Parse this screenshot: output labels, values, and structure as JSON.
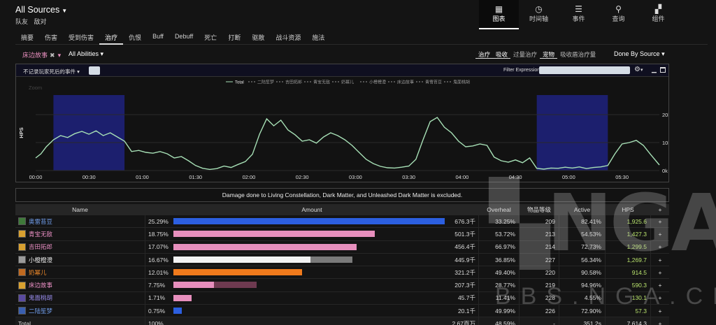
{
  "header": {
    "source_title": "All Sources",
    "source_sub": [
      "队友",
      "敌对"
    ],
    "nav": [
      {
        "label": "图表",
        "icon": "grid-icon",
        "glyph": "▦",
        "active": true
      },
      {
        "label": "时间轴",
        "icon": "clock-icon",
        "glyph": "◷",
        "active": false
      },
      {
        "label": "事件",
        "icon": "list-icon",
        "glyph": "☰",
        "active": false
      },
      {
        "label": "查询",
        "icon": "pin-icon",
        "glyph": "⚲",
        "active": false
      },
      {
        "label": "组件",
        "icon": "widgets-icon",
        "glyph": "▞",
        "active": false
      }
    ]
  },
  "tabs": [
    "摘要",
    "伤害",
    "受到伤害",
    "治疗",
    "仇恨",
    "Buff",
    "Debuff",
    "死亡",
    "打断",
    "驱散",
    "战斗资源",
    "施法"
  ],
  "active_tab": "治疗",
  "filters": {
    "player": "床边故事",
    "abilities": "All Abilities",
    "metric_tabs": [
      "治疗",
      "吸收",
      "过量治疗",
      "宠物",
      "吸收盾治疗量"
    ],
    "metric_active": [
      true,
      true,
      false,
      true,
      false
    ],
    "done_by": "Done By Source"
  },
  "chart_panel": {
    "death_filter": "不记录玩家死后的事件",
    "filter_label": "Filter Expression:"
  },
  "chart_data": {
    "type": "line",
    "legend": [
      "Total",
      "二陆笙梦",
      "吉田拓郎",
      "青宝无敌",
      "奶幂儿",
      "小橙橙澄",
      "床边故事",
      "青雪苔豆",
      "鬼面桃胡"
    ],
    "zoom_label": "Zoom",
    "ylabel": "HPS",
    "ylim": [
      0,
      27000
    ],
    "yticks": [
      "0k",
      "10k",
      "20k"
    ],
    "xlim": [
      0,
      351
    ],
    "xticks": [
      "00:00",
      "00:30",
      "01:00",
      "01:30",
      "02:00",
      "02:30",
      "03:00",
      "03:30",
      "04:00",
      "04:30",
      "05:00",
      "05:30"
    ],
    "highlight_ranges": [
      [
        10,
        50
      ],
      [
        282,
        322
      ]
    ],
    "series": [
      {
        "name": "Total",
        "color": "#a7e0b6",
        "x": [
          0,
          3,
          6,
          10,
          14,
          18,
          22,
          26,
          30,
          34,
          38,
          42,
          46,
          50,
          54,
          58,
          62,
          66,
          70,
          74,
          78,
          82,
          86,
          90,
          94,
          98,
          102,
          106,
          110,
          114,
          118,
          122,
          126,
          130,
          134,
          138,
          142,
          146,
          150,
          154,
          158,
          162,
          166,
          170,
          174,
          178,
          182,
          186,
          190,
          194,
          198,
          202,
          206,
          210,
          214,
          218,
          222,
          226,
          230,
          234,
          238,
          242,
          246,
          250,
          254,
          258,
          262,
          266,
          270,
          274,
          278,
          282,
          286,
          290,
          294,
          298,
          302,
          306,
          310,
          314,
          318,
          322,
          326,
          330,
          334,
          338,
          342,
          346,
          351
        ],
        "y": [
          4500,
          6000,
          8500,
          11000,
          12500,
          11800,
          13200,
          14000,
          13000,
          14200,
          12500,
          13500,
          12000,
          10500,
          6800,
          7200,
          6500,
          6200,
          6800,
          6000,
          4500,
          5000,
          3500,
          1800,
          800,
          400,
          700,
          1600,
          1100,
          2200,
          3200,
          5800,
          13000,
          18500,
          16000,
          18000,
          14500,
          12800,
          10500,
          11000,
          9800,
          12000,
          13500,
          12500,
          11000,
          9000,
          6500,
          4000,
          2500,
          1500,
          1000,
          900,
          1200,
          1600,
          4000,
          11000,
          17500,
          19000,
          15500,
          13500,
          10500,
          8500,
          8800,
          9500,
          9000,
          4800,
          3500,
          3000,
          3800,
          2800,
          4500,
          800,
          500,
          900,
          800,
          1200,
          900,
          1300,
          700,
          1100,
          1300,
          1800,
          6000,
          9500,
          10000,
          10800,
          9000,
          5800,
          2000
        ]
      }
    ]
  },
  "notice": "Damage done to Living Constellation, Dark Matter, and Unleashed Dark Matter is excluded.",
  "table": {
    "headers": [
      "Name",
      "Amount",
      "Overheal",
      "物品等级",
      "Active",
      "HPS",
      "+"
    ],
    "rows": [
      {
        "name": "奥雷苔豆",
        "color": "#6f9be8",
        "icon_color": "#3f7a3a",
        "pct": "25.29%",
        "bar_pct": 100,
        "bar_color": "#2c5fe0",
        "bar2_pct": 0,
        "bar2_color": "#4a4a6a",
        "amount": "676.3千",
        "overheal": "33.25%",
        "ilvl": "209",
        "active": "82.41%",
        "hps": "1,925.6"
      },
      {
        "name": "青宝无敌",
        "color": "#ea8fc4",
        "icon_color": "#d8a030",
        "pct": "18.75%",
        "bar_pct": 74.1,
        "bar_color": "#e78fbd",
        "bar2_pct": 0,
        "bar2_color": "#7a4a60",
        "amount": "501.3千",
        "overheal": "53.72%",
        "ilvl": "213",
        "active": "54.53%",
        "hps": "1,427.3"
      },
      {
        "name": "吉田拓郎",
        "color": "#ea8fc4",
        "icon_color": "#d8a030",
        "pct": "17.07%",
        "bar_pct": 67.5,
        "bar_color": "#e78fbd",
        "bar2_pct": 0,
        "bar2_color": "#7a4a60",
        "amount": "456.4千",
        "overheal": "66.97%",
        "ilvl": "214",
        "active": "72.73%",
        "hps": "1,299.5"
      },
      {
        "name": "小橙橙澄",
        "color": "#f2f2f2",
        "icon_color": "#9a9a9a",
        "pct": "16.67%",
        "bar_pct": 50.5,
        "bar_color": "#f2f2f2",
        "bar2_pct": 15.4,
        "bar2_color": "#7a7a7a",
        "amount": "445.9千",
        "overheal": "36.85%",
        "ilvl": "227",
        "active": "56.34%",
        "hps": "1,269.7"
      },
      {
        "name": "奶幂儿",
        "color": "#f08a2a",
        "icon_color": "#c06a20",
        "pct": "12.01%",
        "bar_pct": 47.5,
        "bar_color": "#f07a1c",
        "bar2_pct": 0,
        "bar2_color": "#6a4020",
        "amount": "321.2千",
        "overheal": "49.40%",
        "ilvl": "220",
        "active": "90.58%",
        "hps": "914.5"
      },
      {
        "name": "床边故事",
        "color": "#ea8fc4",
        "icon_color": "#d8a030",
        "pct": "7.75%",
        "bar_pct": 15.0,
        "bar_color": "#e78fbd",
        "bar2_pct": 15.6,
        "bar2_color": "#6e3a50",
        "amount": "207.3千",
        "overheal": "28.77%",
        "ilvl": "219",
        "active": "94.96%",
        "hps": "590.3"
      },
      {
        "name": "鬼面桃胡",
        "color": "#9b8ef0",
        "icon_color": "#5a4aa0",
        "pct": "1.71%",
        "bar_pct": 6.8,
        "bar_color": "#e78fbd",
        "bar2_pct": 0,
        "bar2_color": "#6e3a50",
        "amount": "45.7千",
        "overheal": "11.41%",
        "ilvl": "228",
        "active": "4.55%",
        "hps": "130.1"
      },
      {
        "name": "二陆笙梦",
        "color": "#6f9be8",
        "icon_color": "#3a5fb0",
        "pct": "0.75%",
        "bar_pct": 3.0,
        "bar_color": "#2c5fe0",
        "bar2_pct": 0,
        "bar2_color": "#4a4a6a",
        "amount": "20.1千",
        "overheal": "49.99%",
        "ilvl": "226",
        "active": "72.90%",
        "hps": "57.3"
      }
    ],
    "total": {
      "name": "Total",
      "pct": "100%",
      "amount": "2.67百万",
      "overheal": "48.59%",
      "ilvl": "-",
      "active": "351.2s",
      "hps": "7,614.3"
    }
  },
  "watermark": {
    "logo_text": "NGA",
    "url_text": "BBS.NGA.CN"
  },
  "colors": {
    "bg": "#141414",
    "highlight": "#1c1f6e",
    "line": "#a7e0b6",
    "hps_text": "#b9e36d"
  }
}
